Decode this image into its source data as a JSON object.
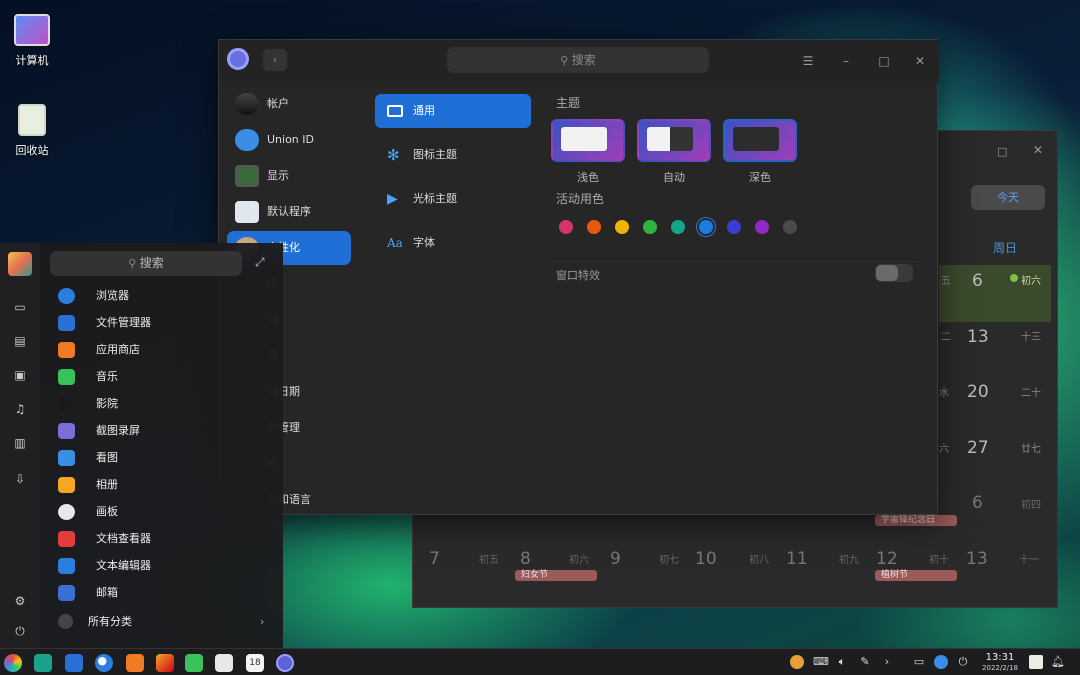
{
  "desktop": {
    "icons": [
      {
        "label": "计算机"
      },
      {
        "label": "回收站"
      }
    ]
  },
  "settings": {
    "search_placeholder": "搜索",
    "nav": [
      {
        "label": "帐户",
        "icon": "account-icon"
      },
      {
        "label": "Union ID",
        "icon": "cloud-icon"
      },
      {
        "label": "显示",
        "icon": "display-icon"
      },
      {
        "label": "默认程序",
        "icon": "default-apps-icon"
      },
      {
        "label": "个性化",
        "icon": "personalization-icon",
        "selected": true
      },
      {
        "label": "络",
        "icon": "network-icon"
      },
      {
        "label": "知",
        "icon": "notification-icon"
      },
      {
        "label": "音",
        "icon": "sound-icon"
      },
      {
        "label": "间日期",
        "icon": "datetime-icon"
      },
      {
        "label": "源管理",
        "icon": "power-icon"
      },
      {
        "label": "标",
        "icon": "mouse-icon"
      },
      {
        "label": "盘和语言",
        "icon": "keyboard-icon"
      }
    ],
    "subnav": [
      {
        "label": "通用",
        "icon": "general-icon",
        "selected": true
      },
      {
        "label": "图标主题",
        "icon": "icon-theme-icon"
      },
      {
        "label": "光标主题",
        "icon": "cursor-theme-icon"
      },
      {
        "label": "字体",
        "icon": "font-icon"
      }
    ],
    "theme_heading": "主题",
    "themes": [
      {
        "label": "浅色"
      },
      {
        "label": "自动"
      },
      {
        "label": "深色",
        "selected": true
      }
    ],
    "accent_heading": "活动用色",
    "accent_colors": [
      "#d6336c",
      "#e8590c",
      "#f0b400",
      "#2fb343",
      "#12a589",
      "#1e7be0",
      "#3b3bd6",
      "#8f2ac9",
      "#4a4a4a"
    ],
    "effects_label": "窗口特效",
    "effects_enabled": false
  },
  "calendar": {
    "today_button": "今天",
    "weekday_header": "周日",
    "rows": [
      {
        "wd": "五",
        "day": "6",
        "lunar": "初六"
      },
      {
        "wd": "二",
        "day": "13",
        "lunar": "十三"
      },
      {
        "wd": "水",
        "day": "20",
        "lunar": "二十"
      },
      {
        "wd": "六",
        "day": "27",
        "lunar": "廿七"
      },
      {
        "wd": "",
        "day": "6",
        "lunar": "初四"
      }
    ],
    "festival_row5": "学雷锋纪念日",
    "bottom_row": [
      {
        "day": "7",
        "lunar": "初五"
      },
      {
        "day": "8",
        "lunar": "初六"
      },
      {
        "day": "9",
        "lunar": "初七"
      },
      {
        "day": "10",
        "lunar": "初八"
      },
      {
        "day": "11",
        "lunar": "初九"
      },
      {
        "day": "12",
        "lunar": "初十"
      },
      {
        "day": "13",
        "lunar": "十一"
      }
    ],
    "festivals": [
      "妇女节",
      "植树节"
    ]
  },
  "launcher": {
    "search_placeholder": "搜索",
    "apps": [
      {
        "label": "浏览器",
        "icon": "browser-icon"
      },
      {
        "label": "文件管理器",
        "icon": "file-manager-icon"
      },
      {
        "label": "应用商店",
        "icon": "app-store-icon"
      },
      {
        "label": "音乐",
        "icon": "music-icon"
      },
      {
        "label": "影院",
        "icon": "movie-icon"
      },
      {
        "label": "截图录屏",
        "icon": "screenshot-icon"
      },
      {
        "label": "看图",
        "icon": "image-viewer-icon"
      },
      {
        "label": "相册",
        "icon": "album-icon"
      },
      {
        "label": "画板",
        "icon": "draw-icon"
      },
      {
        "label": "文档查看器",
        "icon": "document-viewer-icon"
      },
      {
        "label": "文本编辑器",
        "icon": "text-editor-icon"
      },
      {
        "label": "邮箱",
        "icon": "mail-icon"
      }
    ],
    "all_categories": "所有分类"
  },
  "taskbar": {
    "time": "13:31",
    "date": "2022/2/18",
    "calendar_day": "18"
  }
}
